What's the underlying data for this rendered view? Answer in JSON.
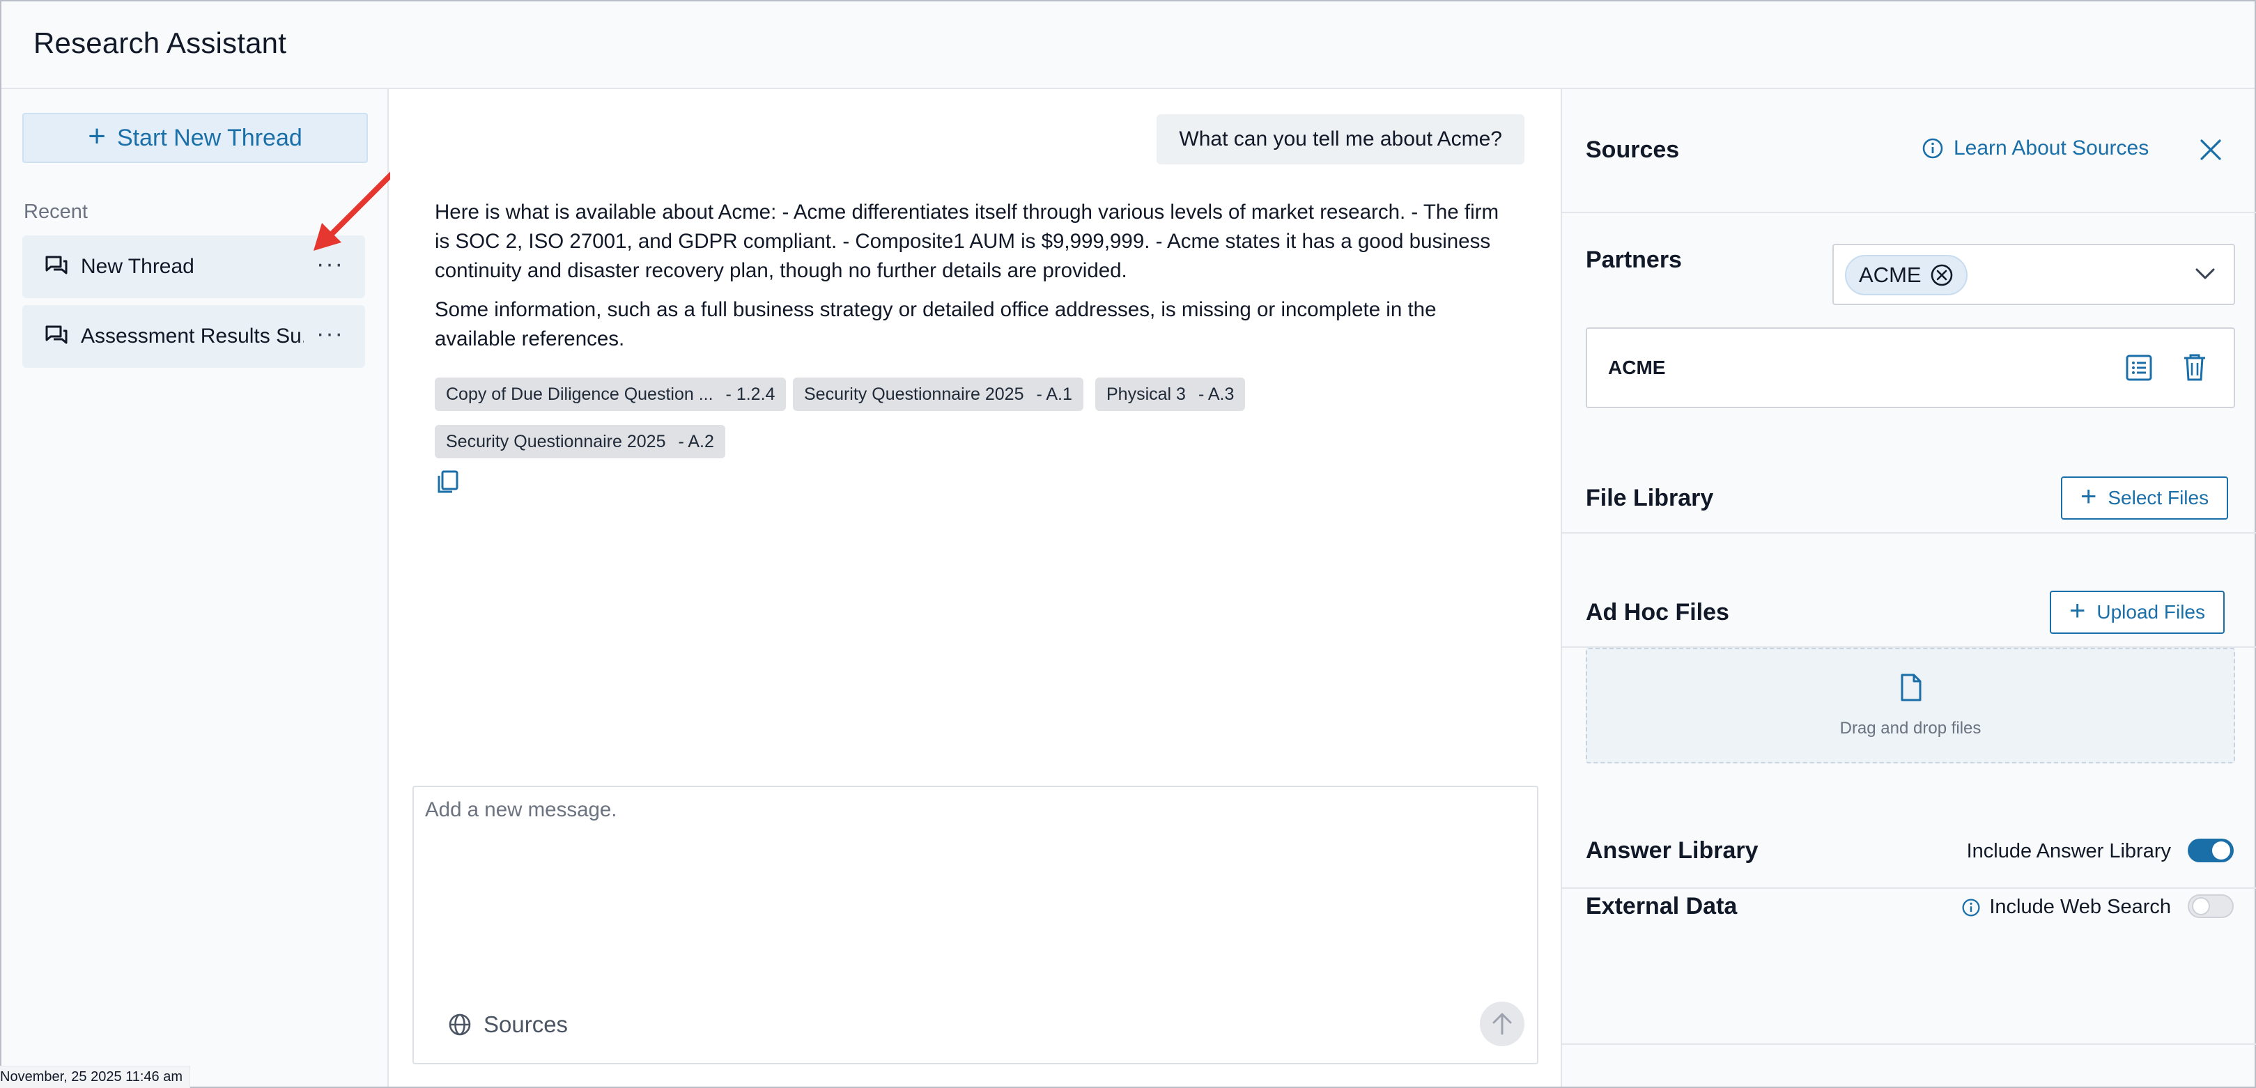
{
  "app": {
    "title": "Research Assistant"
  },
  "sidebar": {
    "new_thread_label": "Start New Thread",
    "recent_label": "Recent",
    "threads": [
      {
        "label": "New Thread",
        "more": "···"
      },
      {
        "label": "Assessment Results Su...",
        "more": "···"
      }
    ]
  },
  "chat": {
    "user_message": "What can you tell me about Acme?",
    "answer_p1": "Here is what is available about Acme: - Acme differentiates itself through various levels of market research. - The firm is SOC 2, ISO 27001, and GDPR compliant. - Composite1 AUM is $9,999,999. - Acme states it has a good business continuity and disaster recovery plan, though no further details are provided.",
    "answer_p2": "Some information, such as a full business strategy or detailed office addresses, is missing or incomplete in the available references.",
    "citations": [
      {
        "title": "Copy of Due Diligence Question ...",
        "ref": "- 1.2.4"
      },
      {
        "title": "Security Questionnaire 2025",
        "ref": "- A.1"
      },
      {
        "title": "Physical 3",
        "ref": "- A.3"
      },
      {
        "title": "Security Questionnaire 2025",
        "ref": "- A.2"
      }
    ]
  },
  "composer": {
    "placeholder": "Add a new message.",
    "sources_label": "Sources"
  },
  "panel": {
    "sources_title": "Sources",
    "learn_label": "Learn About Sources",
    "partners_title": "Partners",
    "partner_tag": "ACME",
    "partner_card_name": "ACME",
    "file_library_title": "File Library",
    "select_files_label": "Select Files",
    "adhoc_title": "Ad Hoc Files",
    "upload_files_label": "Upload Files",
    "drop_text": "Drag and drop files",
    "answer_library_title": "Answer Library",
    "answer_library_toggle_label": "Include Answer Library",
    "answer_library_on": true,
    "external_title": "External Data",
    "web_search_label": "Include Web Search",
    "web_search_on": false
  },
  "status": {
    "timestamp": "November, 25 2025 11:46 am"
  },
  "colors": {
    "accent": "#1b6fa8",
    "annotation_arrow": "#e5372f"
  }
}
